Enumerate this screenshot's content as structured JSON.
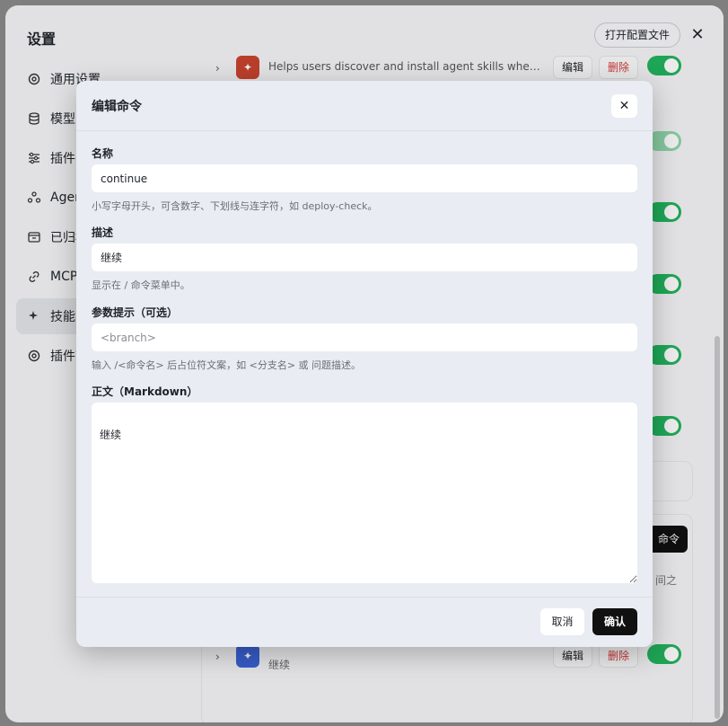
{
  "window": {
    "title": "设置",
    "open_config_label": "打开配置文件",
    "close_glyph": "✕"
  },
  "sidebar": {
    "items": [
      {
        "label": "通用设置",
        "icon": "gear-icon"
      },
      {
        "label": "模型",
        "icon": "database-icon"
      },
      {
        "label": "插件",
        "icon": "sliders-icon"
      },
      {
        "label": "Agent",
        "icon": "agent-icon"
      },
      {
        "label": "已归档",
        "icon": "archive-icon"
      },
      {
        "label": "MCP",
        "icon": "link-icon"
      },
      {
        "label": "技能与命令",
        "icon": "sparkle-icon",
        "active": true
      },
      {
        "label": "插件市场",
        "icon": "gear-icon"
      }
    ]
  },
  "background": {
    "skill_first": {
      "description": "Helps users discover and install agent skills when they a...",
      "edit": "编辑",
      "delete": "删除",
      "icon_color": "#c9452f"
    },
    "skill_last": {
      "subtitle": "继续",
      "edit": "编辑",
      "delete": "删除",
      "icon_color": "#3b63d6"
    },
    "new_command_partial": "命令",
    "peek_text": "间之"
  },
  "modal": {
    "title": "编辑命令",
    "close_glyph": "✕",
    "name": {
      "label": "名称",
      "value": "continue",
      "hint": "小写字母开头，可含数字、下划线与连字符，如 deploy-check。"
    },
    "description": {
      "label": "描述",
      "value": "继续",
      "hint": "显示在 / 命令菜单中。"
    },
    "arg_hint": {
      "label": "参数提示（可选）",
      "value": "",
      "placeholder": "<branch>",
      "hint": "输入 /<命令名> 后占位符文案，如 <分支名> 或 问题描述。"
    },
    "body": {
      "label": "正文（Markdown）",
      "value": "继续"
    },
    "cancel_label": "取消",
    "confirm_label": "确认"
  },
  "colors": {
    "toggle_on": "#22b35e",
    "confirm_bg": "#111111",
    "delete_text": "#d43a3a"
  }
}
